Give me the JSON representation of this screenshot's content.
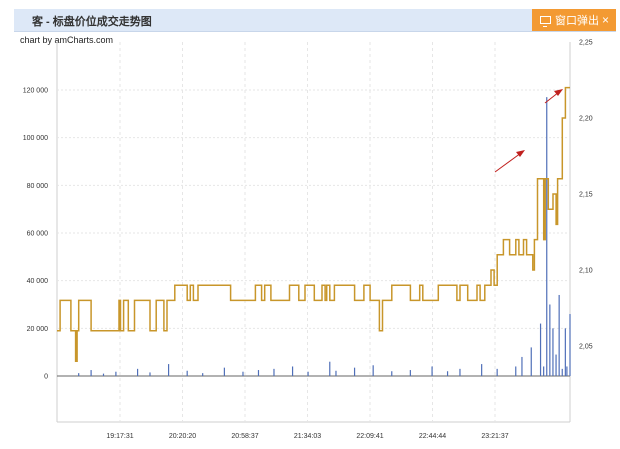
{
  "window": {
    "title": "客 - 标盘价位成交走势图",
    "popout_label": "窗口弹出",
    "close_glyph": "×"
  },
  "credit": "chart by amCharts.com",
  "colors": {
    "price_line": "#c8962a",
    "volume_bars": "#4f6fb8",
    "annotation_arrows": "#c0201e",
    "popout_button": "#f39a33",
    "title_bar": "#dde8f7"
  },
  "chart_data": {
    "type": "line",
    "title": "",
    "x_ticks": [
      "19:17:31",
      "20:20:20",
      "20:58:37",
      "21:34:03",
      "22:09:41",
      "22:44:44",
      "23:21:37"
    ],
    "y_left": {
      "ylim": [
        0,
        130000
      ],
      "ticks": [
        "0",
        "20 000",
        "40 000",
        "60 000",
        "80 000",
        "100 000",
        "120 000"
      ],
      "tick_values": [
        0,
        20000,
        40000,
        60000,
        80000,
        100000,
        120000
      ]
    },
    "y_right": {
      "ylim": [
        2.03,
        2.25
      ],
      "ticks": [
        "2,05",
        "2,10",
        "2,15",
        "2,20",
        "2,25"
      ],
      "tick_values": [
        2.05,
        2.1,
        2.15,
        2.2,
        2.25
      ]
    },
    "grid": true,
    "series": [
      {
        "axis": "right",
        "color": "#c8962a",
        "points": [
          [
            0.0,
            2.06
          ],
          [
            0.01,
            2.06
          ],
          [
            0.01,
            2.08
          ],
          [
            0.045,
            2.08
          ],
          [
            0.045,
            2.06
          ],
          [
            0.06,
            2.06
          ],
          [
            0.06,
            2.04
          ],
          [
            0.065,
            2.04
          ],
          [
            0.065,
            2.06
          ],
          [
            0.07,
            2.06
          ],
          [
            0.07,
            2.08
          ],
          [
            0.11,
            2.08
          ],
          [
            0.11,
            2.06
          ],
          [
            0.2,
            2.06
          ],
          [
            0.2,
            2.08
          ],
          [
            0.205,
            2.08
          ],
          [
            0.205,
            2.06
          ],
          [
            0.215,
            2.06
          ],
          [
            0.215,
            2.08
          ],
          [
            0.23,
            2.08
          ],
          [
            0.23,
            2.06
          ],
          [
            0.25,
            2.06
          ],
          [
            0.25,
            2.08
          ],
          [
            0.3,
            2.08
          ],
          [
            0.3,
            2.06
          ],
          [
            0.32,
            2.06
          ],
          [
            0.32,
            2.08
          ],
          [
            0.345,
            2.08
          ],
          [
            0.345,
            2.06
          ],
          [
            0.355,
            2.06
          ],
          [
            0.355,
            2.08
          ],
          [
            0.38,
            2.08
          ],
          [
            0.38,
            2.09
          ],
          [
            0.42,
            2.09
          ],
          [
            0.42,
            2.08
          ],
          [
            0.43,
            2.08
          ],
          [
            0.43,
            2.09
          ],
          [
            0.44,
            2.09
          ],
          [
            0.44,
            2.08
          ],
          [
            0.455,
            2.08
          ],
          [
            0.455,
            2.09
          ],
          [
            0.56,
            2.09
          ],
          [
            0.56,
            2.08
          ],
          [
            0.64,
            2.08
          ],
          [
            0.64,
            2.09
          ],
          [
            0.66,
            2.09
          ],
          [
            0.66,
            2.08
          ],
          [
            0.67,
            2.08
          ],
          [
            0.67,
            2.09
          ],
          [
            0.69,
            2.09
          ],
          [
            0.69,
            2.08
          ],
          [
            0.75,
            2.08
          ],
          [
            0.75,
            2.09
          ],
          [
            0.78,
            2.09
          ],
          [
            0.78,
            2.08
          ],
          [
            0.8,
            2.08
          ],
          [
            0.8,
            2.09
          ],
          [
            0.83,
            2.09
          ],
          [
            0.83,
            2.08
          ],
          [
            0.855,
            2.08
          ],
          [
            0.855,
            2.09
          ],
          [
            0.865,
            2.09
          ],
          [
            0.865,
            2.08
          ],
          [
            0.87,
            2.08
          ],
          [
            0.87,
            2.09
          ],
          [
            0.88,
            2.09
          ],
          [
            0.88,
            2.08
          ],
          [
            0.895,
            2.08
          ],
          [
            0.895,
            2.09
          ],
          [
            0.96,
            2.09
          ],
          [
            0.96,
            2.08
          ],
          [
            0.99,
            2.08
          ],
          [
            0.99,
            2.09
          ],
          [
            1.01,
            2.09
          ],
          [
            1.01,
            2.08
          ],
          [
            1.04,
            2.08
          ],
          [
            1.04,
            2.06
          ],
          [
            1.05,
            2.06
          ],
          [
            1.05,
            2.08
          ],
          [
            1.08,
            2.08
          ],
          [
            1.08,
            2.09
          ],
          [
            1.14,
            2.09
          ],
          [
            1.14,
            2.08
          ],
          [
            1.17,
            2.08
          ],
          [
            1.17,
            2.09
          ],
          [
            1.18,
            2.09
          ],
          [
            1.18,
            2.08
          ],
          [
            1.23,
            2.08
          ],
          [
            1.23,
            2.09
          ],
          [
            1.29,
            2.09
          ],
          [
            1.29,
            2.08
          ],
          [
            1.3,
            2.08
          ],
          [
            1.3,
            2.09
          ],
          [
            1.325,
            2.09
          ],
          [
            1.325,
            2.08
          ],
          [
            1.355,
            2.08
          ],
          [
            1.355,
            2.09
          ],
          [
            1.365,
            2.09
          ],
          [
            1.365,
            2.08
          ],
          [
            1.38,
            2.08
          ],
          [
            1.38,
            2.09
          ],
          [
            1.4,
            2.09
          ],
          [
            1.4,
            2.1
          ],
          [
            1.41,
            2.1
          ],
          [
            1.41,
            2.09
          ],
          [
            1.42,
            2.09
          ],
          [
            1.42,
            2.11
          ],
          [
            1.44,
            2.11
          ],
          [
            1.44,
            2.12
          ],
          [
            1.46,
            2.12
          ],
          [
            1.46,
            2.11
          ],
          [
            1.48,
            2.11
          ],
          [
            1.48,
            2.12
          ],
          [
            1.49,
            2.12
          ],
          [
            1.49,
            2.11
          ],
          [
            1.505,
            2.11
          ],
          [
            1.505,
            2.12
          ],
          [
            1.515,
            2.12
          ],
          [
            1.515,
            2.11
          ],
          [
            1.535,
            2.11
          ],
          [
            1.535,
            2.1
          ],
          [
            1.54,
            2.1
          ],
          [
            1.54,
            2.12
          ],
          [
            1.55,
            2.12
          ],
          [
            1.55,
            2.16
          ],
          [
            1.57,
            2.16
          ],
          [
            1.57,
            2.12
          ],
          [
            1.575,
            2.12
          ],
          [
            1.575,
            2.16
          ],
          [
            1.585,
            2.16
          ],
          [
            1.585,
            2.14
          ],
          [
            1.6,
            2.14
          ],
          [
            1.6,
            2.15
          ],
          [
            1.61,
            2.15
          ],
          [
            1.61,
            2.13
          ],
          [
            1.615,
            2.13
          ],
          [
            1.615,
            2.16
          ],
          [
            1.63,
            2.16
          ],
          [
            1.63,
            2.2
          ],
          [
            1.64,
            2.2
          ],
          [
            1.64,
            2.22
          ],
          [
            1.655,
            2.22
          ]
        ]
      },
      {
        "axis": "left",
        "color": "#4f6fb8",
        "points": [
          [
            0.07,
            1200
          ],
          [
            0.11,
            2500
          ],
          [
            0.15,
            1000
          ],
          [
            0.19,
            1800
          ],
          [
            0.26,
            3000
          ],
          [
            0.3,
            1500
          ],
          [
            0.36,
            5000
          ],
          [
            0.42,
            2200
          ],
          [
            0.47,
            1200
          ],
          [
            0.54,
            3500
          ],
          [
            0.6,
            1800
          ],
          [
            0.65,
            2500
          ],
          [
            0.7,
            3000
          ],
          [
            0.76,
            4000
          ],
          [
            0.81,
            1800
          ],
          [
            0.88,
            6000
          ],
          [
            0.9,
            2200
          ],
          [
            0.96,
            3500
          ],
          [
            1.02,
            4500
          ],
          [
            1.08,
            2000
          ],
          [
            1.14,
            2500
          ],
          [
            1.21,
            4000
          ],
          [
            1.26,
            2000
          ],
          [
            1.3,
            3000
          ],
          [
            1.37,
            5000
          ],
          [
            1.42,
            3000
          ],
          [
            1.48,
            4000
          ],
          [
            1.5,
            8000
          ],
          [
            1.53,
            12000
          ],
          [
            1.56,
            22000
          ],
          [
            1.57,
            4000
          ],
          [
            1.58,
            117000
          ],
          [
            1.59,
            30000
          ],
          [
            1.6,
            20000
          ],
          [
            1.61,
            9000
          ],
          [
            1.62,
            34000
          ],
          [
            1.63,
            3000
          ],
          [
            1.64,
            20000
          ],
          [
            1.645,
            4000
          ],
          [
            1.655,
            26000
          ]
        ]
      }
    ],
    "annotations": [
      "arrow",
      "arrow"
    ]
  }
}
